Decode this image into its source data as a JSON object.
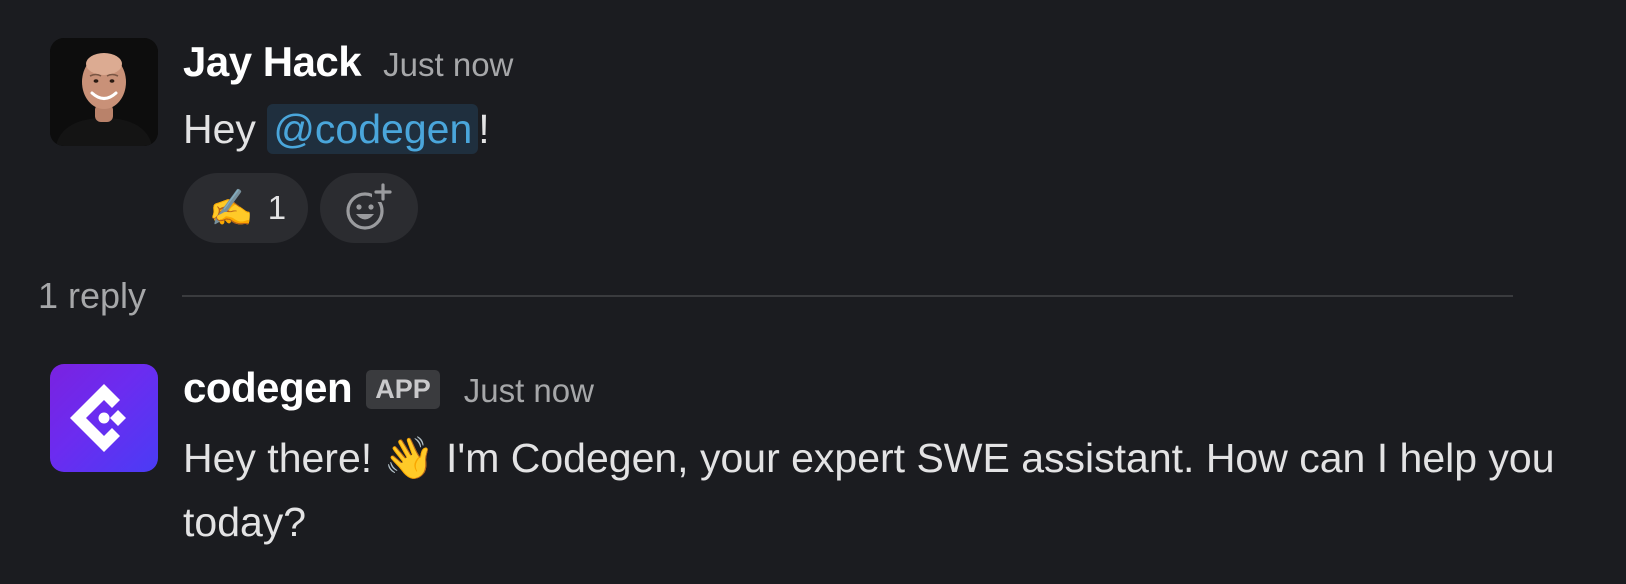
{
  "thread": {
    "parent": {
      "author": "Jay Hack",
      "timestamp": "Just now",
      "text_before": "Hey ",
      "mention": "@codegen",
      "text_after": "!",
      "reactions": [
        {
          "emoji": "✍️",
          "count": "1"
        }
      ],
      "add_reaction_icon": "add-emoji-icon"
    },
    "reply_count": "1 reply",
    "reply": {
      "author": "codegen",
      "badge": "APP",
      "timestamp": "Just now",
      "text_before_emoji": "Hey there! ",
      "emoji": "👋",
      "text_after_emoji": " I'm Codegen, your expert SWE assistant. How can I help you today?"
    }
  },
  "colors": {
    "background": "#1b1c20",
    "mention_text": "#4aa6db",
    "mention_bg": "#1f2f3e",
    "app_avatar_gradient_start": "#7a22e0",
    "app_avatar_gradient_end": "#4a3cf5"
  }
}
